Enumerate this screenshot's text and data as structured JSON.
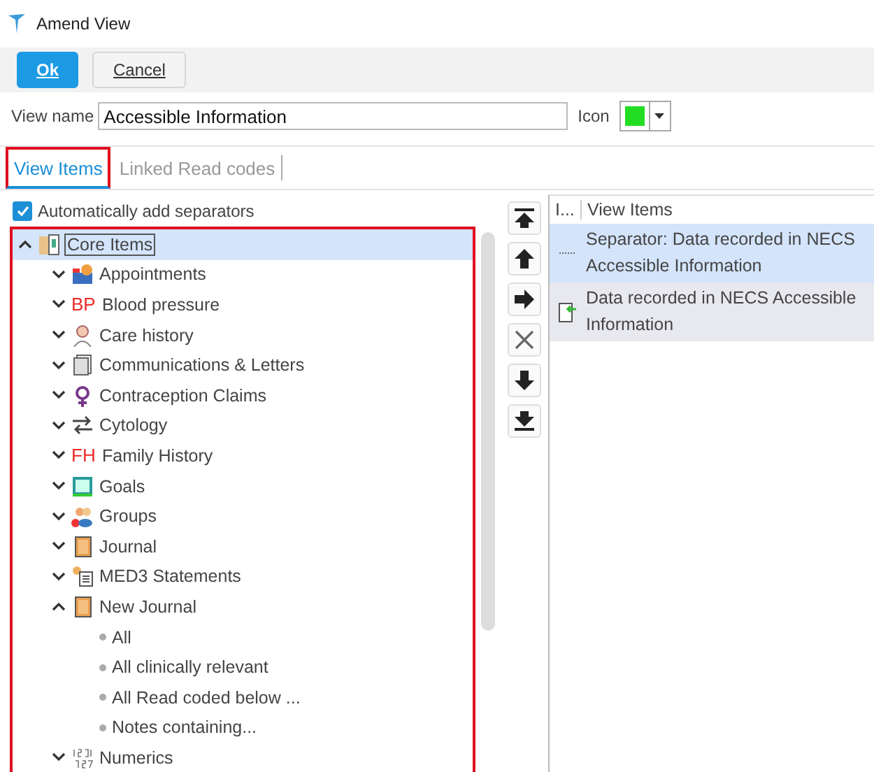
{
  "window": {
    "title": "Amend View"
  },
  "buttons": [
    {
      "label": "Ok",
      "kind": "primary"
    },
    {
      "label": "Cancel",
      "kind": "secondary"
    }
  ],
  "view_name": {
    "label": "View name",
    "value": "Accessible Information"
  },
  "icon_picker": {
    "label": "Icon",
    "color": "#22dd22"
  },
  "tabs": [
    {
      "label": "View Items",
      "selected": true
    },
    {
      "label": "Linked Read codes",
      "selected": false
    }
  ],
  "auto_separators": {
    "label": "Automatically add separators",
    "checked": true
  },
  "tree": [
    {
      "label": "Core Items",
      "kind": "folder",
      "expanded": true,
      "selected": true,
      "children": [
        {
          "label": "Appointments",
          "kind": "calendar",
          "expanded": false,
          "selected": false
        },
        {
          "label": "Blood pressure",
          "kind": "text",
          "badge": "BP",
          "expanded": false,
          "selected": false
        },
        {
          "label": "Care history",
          "kind": "person",
          "expanded": false,
          "selected": false
        },
        {
          "label": "Communications & Letters",
          "kind": "document",
          "expanded": false,
          "selected": false
        },
        {
          "label": "Contraception Claims",
          "kind": "female",
          "expanded": false,
          "selected": false
        },
        {
          "label": "Cytology",
          "kind": "arrows",
          "expanded": false,
          "selected": false
        },
        {
          "label": "Family History",
          "kind": "text",
          "badge": "FH",
          "expanded": false,
          "selected": false
        },
        {
          "label": "Goals",
          "kind": "frame",
          "expanded": false,
          "selected": false
        },
        {
          "label": "Groups",
          "kind": "people",
          "expanded": false,
          "selected": false
        },
        {
          "label": "Journal",
          "kind": "book",
          "expanded": false,
          "selected": false
        },
        {
          "label": "MED3 Statements",
          "kind": "list",
          "expanded": false,
          "selected": false
        },
        {
          "label": "New Journal",
          "kind": "book",
          "expanded": true,
          "selected": false,
          "children": [
            {
              "label": "All",
              "kind": "leaf",
              "selected": false
            },
            {
              "label": "All clinically relevant",
              "kind": "leaf",
              "selected": false
            },
            {
              "label": "All Read coded below ...",
              "kind": "leaf",
              "selected": false
            },
            {
              "label": "Notes containing...",
              "kind": "leaf",
              "selected": false
            }
          ]
        },
        {
          "label": "Numerics",
          "kind": "numbers",
          "expanded": false,
          "selected": false
        }
      ]
    }
  ],
  "move_buttons": [
    {
      "kind": "top"
    },
    {
      "kind": "up"
    },
    {
      "kind": "add"
    },
    {
      "kind": "remove"
    },
    {
      "kind": "down"
    },
    {
      "kind": "bottom"
    }
  ],
  "view_items": {
    "columns": [
      "I...",
      "View Items"
    ],
    "rows": [
      {
        "kind": "separator",
        "text": "Separator: Data recorded in NECS Accessible Information",
        "selected": true
      },
      {
        "kind": "data",
        "text": "Data recorded in NECS Accessible Information",
        "selected": false
      }
    ]
  }
}
